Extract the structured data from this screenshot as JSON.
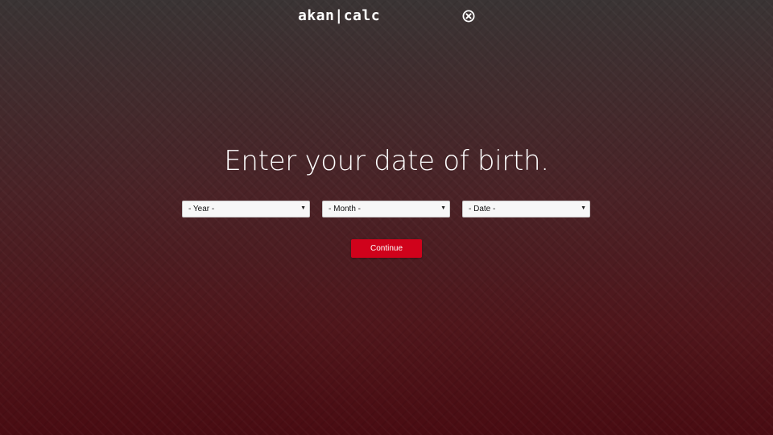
{
  "header": {
    "logo_left": "akan",
    "logo_sep": "|",
    "logo_right": "calc",
    "close_icon": "close-circle-icon"
  },
  "main": {
    "heading": "Enter your date of birth.",
    "selects": {
      "year": {
        "selected": "- Year -"
      },
      "month": {
        "selected": "- Month -"
      },
      "date": {
        "selected": "- Date -"
      }
    },
    "continue_label": "Continue"
  },
  "colors": {
    "accent": "#d0021b",
    "background_top": "#3a3434",
    "background_bottom": "#490c12"
  }
}
